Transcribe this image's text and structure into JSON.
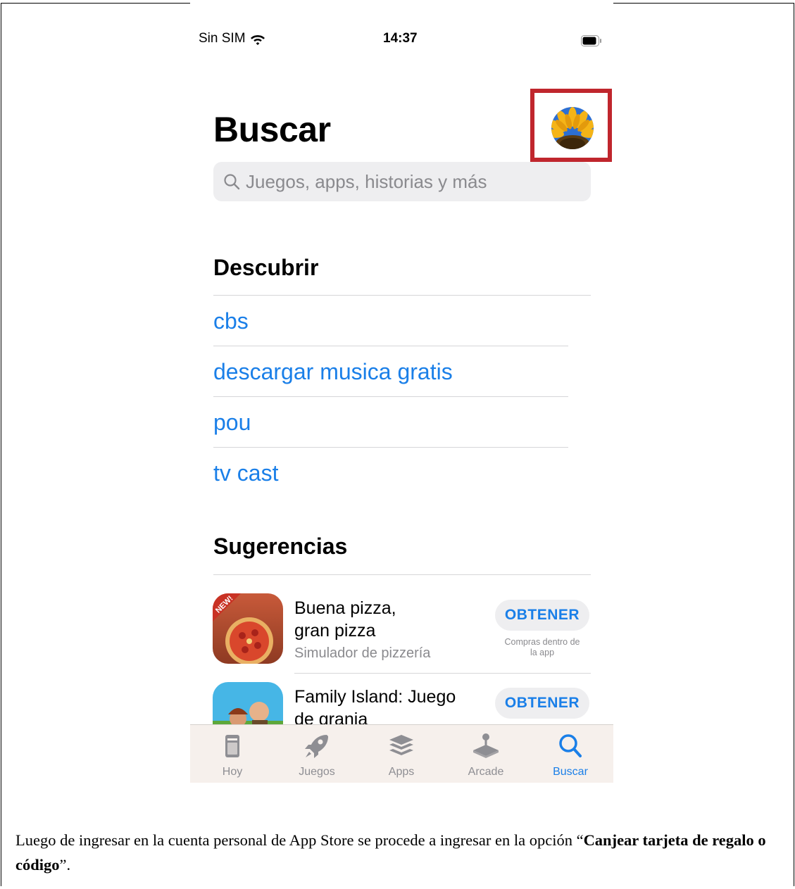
{
  "status_bar": {
    "carrier": "Sin SIM",
    "time": "14:37"
  },
  "header": {
    "title": "Buscar"
  },
  "search": {
    "placeholder": "Juegos, apps, historias y más"
  },
  "discover": {
    "heading": "Descubrir",
    "items": [
      "cbs",
      "descargar musica gratis",
      "pou",
      "tv cast"
    ]
  },
  "suggestions": {
    "heading": "Sugerencias",
    "apps": [
      {
        "name_line1": "Buena pizza,",
        "name_line2": "gran pizza",
        "subtitle": "Simulador de pizzería",
        "button": "OBTENER",
        "iap_line1": "Compras dentro de",
        "iap_line2": "la app",
        "icon_badge": "NEW!"
      },
      {
        "name_line1": "Family Island: Juego",
        "name_line2": "de granja",
        "button": "OBTENER"
      }
    ]
  },
  "tabbar": {
    "tabs": [
      {
        "label": "Hoy",
        "icon": "today-icon"
      },
      {
        "label": "Juegos",
        "icon": "rocket-icon"
      },
      {
        "label": "Apps",
        "icon": "apps-stack-icon"
      },
      {
        "label": "Arcade",
        "icon": "joystick-icon"
      },
      {
        "label": "Buscar",
        "icon": "search-icon",
        "active": true
      }
    ]
  },
  "caption": {
    "text_before": "Luego de ingresar en la cuenta personal de App Store se procede a ingresar en la opción “",
    "bold": "Canjear tarjeta de regalo o código",
    "text_after": "”."
  },
  "colors": {
    "accent": "#1a7fe8",
    "highlight_box": "#c0262d"
  }
}
